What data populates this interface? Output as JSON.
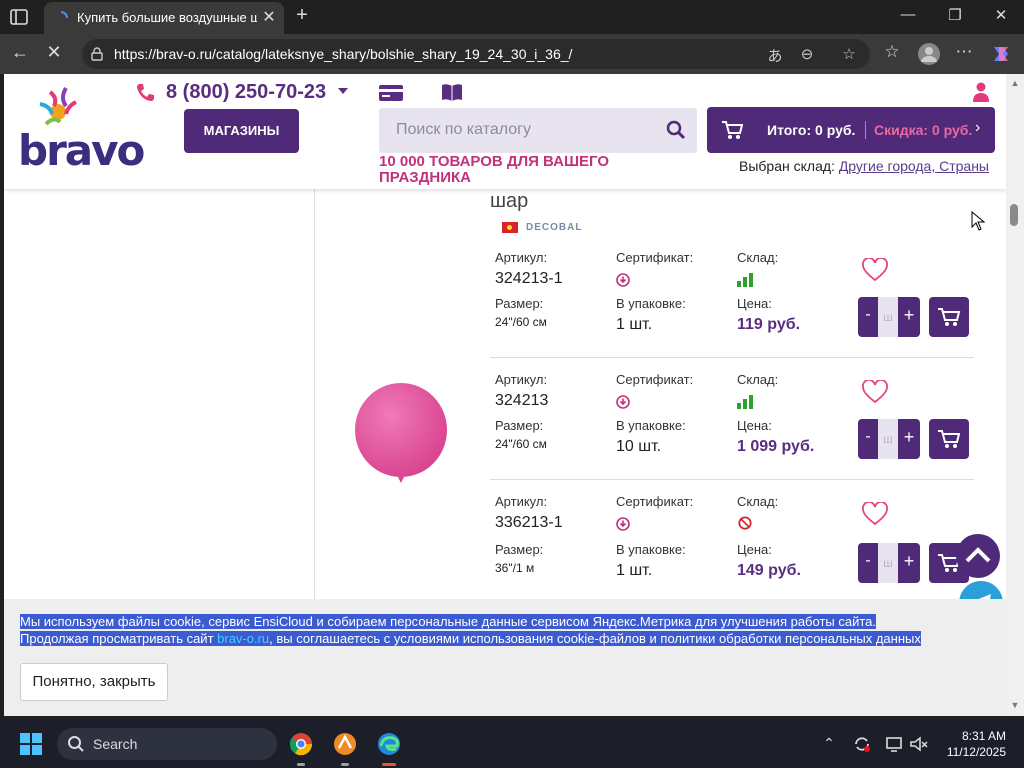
{
  "browser": {
    "tab_title": "Купить большие воздушные шар",
    "tab_close": "✕",
    "new_tab": "+",
    "url": "https://brav-o.ru/catalog/lateksnye_shary/bolshie_shary_19_24_30_i_36_/",
    "window_controls": {
      "minimize": "—",
      "maximize": "❐",
      "close": "✕"
    },
    "back": "←",
    "stop": "✕"
  },
  "site": {
    "logo": "bravo",
    "phone": "8 (800) 250-70-23",
    "shops_button": "МАГАЗИНЫ",
    "search_placeholder": "Поиск по каталогу",
    "cart_total": "Итого: 0 руб.",
    "cart_discount": "Скидка: 0 руб.",
    "cart_chevron": "›",
    "tagline": "10 000 ТОВАРОВ ДЛЯ ВАШЕГО ПРАЗДНИКА",
    "warehouse_label": "Выбран склад:",
    "warehouse_link": "Другие города, Страны"
  },
  "product": {
    "title": "шар",
    "brand": "DECOBAL",
    "labels": {
      "article": "Артикул:",
      "certificate": "Сертификат:",
      "stock": "Склад:",
      "size": "Размер:",
      "pack": "В упаковке:",
      "price": "Цена:"
    },
    "variants": [
      {
        "article": "324213-1",
        "size": "24\"/60 см",
        "pack": "1 шт.",
        "price": "119 руб.",
        "stock": "in-stock",
        "qty_placeholder": "ш",
        "minus": "-",
        "plus": "+"
      },
      {
        "article": "324213",
        "size": "24\"/60 см",
        "pack": "10 шт.",
        "price": "1 099 руб.",
        "stock": "in-stock",
        "qty_placeholder": "ш",
        "minus": "-",
        "plus": "+"
      },
      {
        "article": "336213-1",
        "size": "36\"/1 м",
        "pack": "1 шт.",
        "price": "149 руб.",
        "stock": "out-of-stock",
        "qty_placeholder": "ш",
        "minus": "-",
        "plus": "+"
      }
    ]
  },
  "cookie": {
    "line1": "Мы используем файлы cookie, сервис EnsiCloud и собираем персональные данные сервисом Яндекс.Метрика для улучшения работы сайта.",
    "line2_a": "Продолжая просматривать сайт ",
    "line2_link": "brav-o.ru",
    "line2_b": ", вы соглашаетесь с условиями использования cookie-файлов и политики обработки персональных данных",
    "button": "Понятно, закрыть"
  },
  "taskbar": {
    "search": "Search",
    "time": "8:31 AM",
    "date": "11/12/2025",
    "chevron": "⌃"
  },
  "colors": {
    "brand_purple": "#4e2a78",
    "accent_pink": "#c2327a",
    "balloon": "#e0529c",
    "stock_green": "#2ea12e"
  }
}
